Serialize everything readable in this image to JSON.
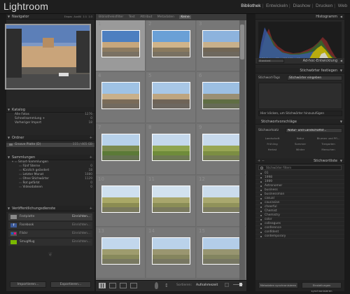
{
  "app": {
    "title": "Lightroom"
  },
  "modules": [
    "Bibliothek",
    "Entwickeln",
    "Diashow",
    "Drucken",
    "Web"
  ],
  "active_module": "Bibliothek",
  "left": {
    "navigator": {
      "title": "Navigator",
      "zoom": [
        "Einpas",
        "Ausfül",
        "1:1",
        "1:3"
      ]
    },
    "catalog": {
      "title": "Katalog",
      "items": [
        {
          "label": "Alle Fotos",
          "count": "1276"
        },
        {
          "label": "Schnellsammlung +",
          "count": "0"
        },
        {
          "label": "Vorheriger Import",
          "count": "18"
        }
      ]
    },
    "folders": {
      "title": "Ordner",
      "item": {
        "label": "Groove Platte (D)",
        "value": "115 / 465 GB"
      }
    },
    "collections": {
      "title": "Sammlungen",
      "parent": "Smart-Sammlungen",
      "items": [
        {
          "label": "Fünf Sterne",
          "count": "0"
        },
        {
          "label": "Kürzlich geändert",
          "count": "18"
        },
        {
          "label": "Letzter Monat",
          "count": "1080"
        },
        {
          "label": "Ohne Stichwörter",
          "count": "1129"
        },
        {
          "label": "Rot gefärbt",
          "count": "0"
        },
        {
          "label": "Videodateien",
          "count": "0"
        }
      ]
    },
    "publish": {
      "title": "Veröffentlichungsdienste",
      "items": [
        {
          "label": "Festplatte",
          "action": "Einrichten..."
        },
        {
          "label": "Facebook",
          "action": "Einrichten..."
        },
        {
          "label": "Flickr",
          "action": "Einrichten..."
        },
        {
          "label": "SmugMug",
          "action": "Einrichten..."
        }
      ]
    },
    "import_label": "Importieren...",
    "export_label": "Exportieren..."
  },
  "grid": {
    "filter_bar": {
      "label": "Bibliotheksfilter",
      "tabs": [
        "Text",
        "Attribut",
        "Metadaten",
        "Keine"
      ],
      "active": "Keine"
    },
    "cells": [
      "1",
      "2",
      "3",
      "4",
      "5",
      "6",
      "7",
      "8",
      "9",
      "10",
      "11",
      "12",
      "13",
      "14",
      "15"
    ]
  },
  "toolbar": {
    "sort_label": "Sortieren:",
    "sort_value": "Aufnahmezeit"
  },
  "right": {
    "histogram": {
      "title": "Histogramm",
      "readout": [
        "1/50 Sek.",
        "f/8",
        "ISO 100",
        "18 mm"
      ]
    },
    "quick_develop": {
      "preset": "Standard",
      "title": "Ad-hoc-Entwicklung"
    },
    "keywording": {
      "title": "Stichwörter festlegen",
      "tags_label": "Stichwort-Tags",
      "tags_placeholder": "Stichwörter eingeben",
      "hint": "Hier klicken, um Stichwörter hinzuzufügen"
    },
    "suggestions": {
      "title": "Stichwortvorschläge"
    },
    "keyword_set": {
      "label": "Stichwortsatz",
      "value": "Natur- und Landschaftsf...",
      "grid": [
        "Landschaft",
        "Natur",
        "Blumen und Pfl...",
        "Frühling",
        "Sommer",
        "Tiergarten",
        "Herbst",
        "Winter",
        "Menschen"
      ]
    },
    "keyword_list": {
      "title": "Stichwortliste",
      "filter": "Stichwörter filtern",
      "items": [
        "01",
        "1998",
        "1999",
        "Astronomer",
        "business",
        "businessman",
        "casual",
        "caucasian",
        "cheerful",
        "Chemist",
        "Chemistry",
        "color",
        "colleagues",
        "conference",
        "confident",
        "contemporary"
      ]
    },
    "sync_meta": "Metadaten synchronisieren",
    "sync_settings": "Einstellungen synchronisieren"
  }
}
